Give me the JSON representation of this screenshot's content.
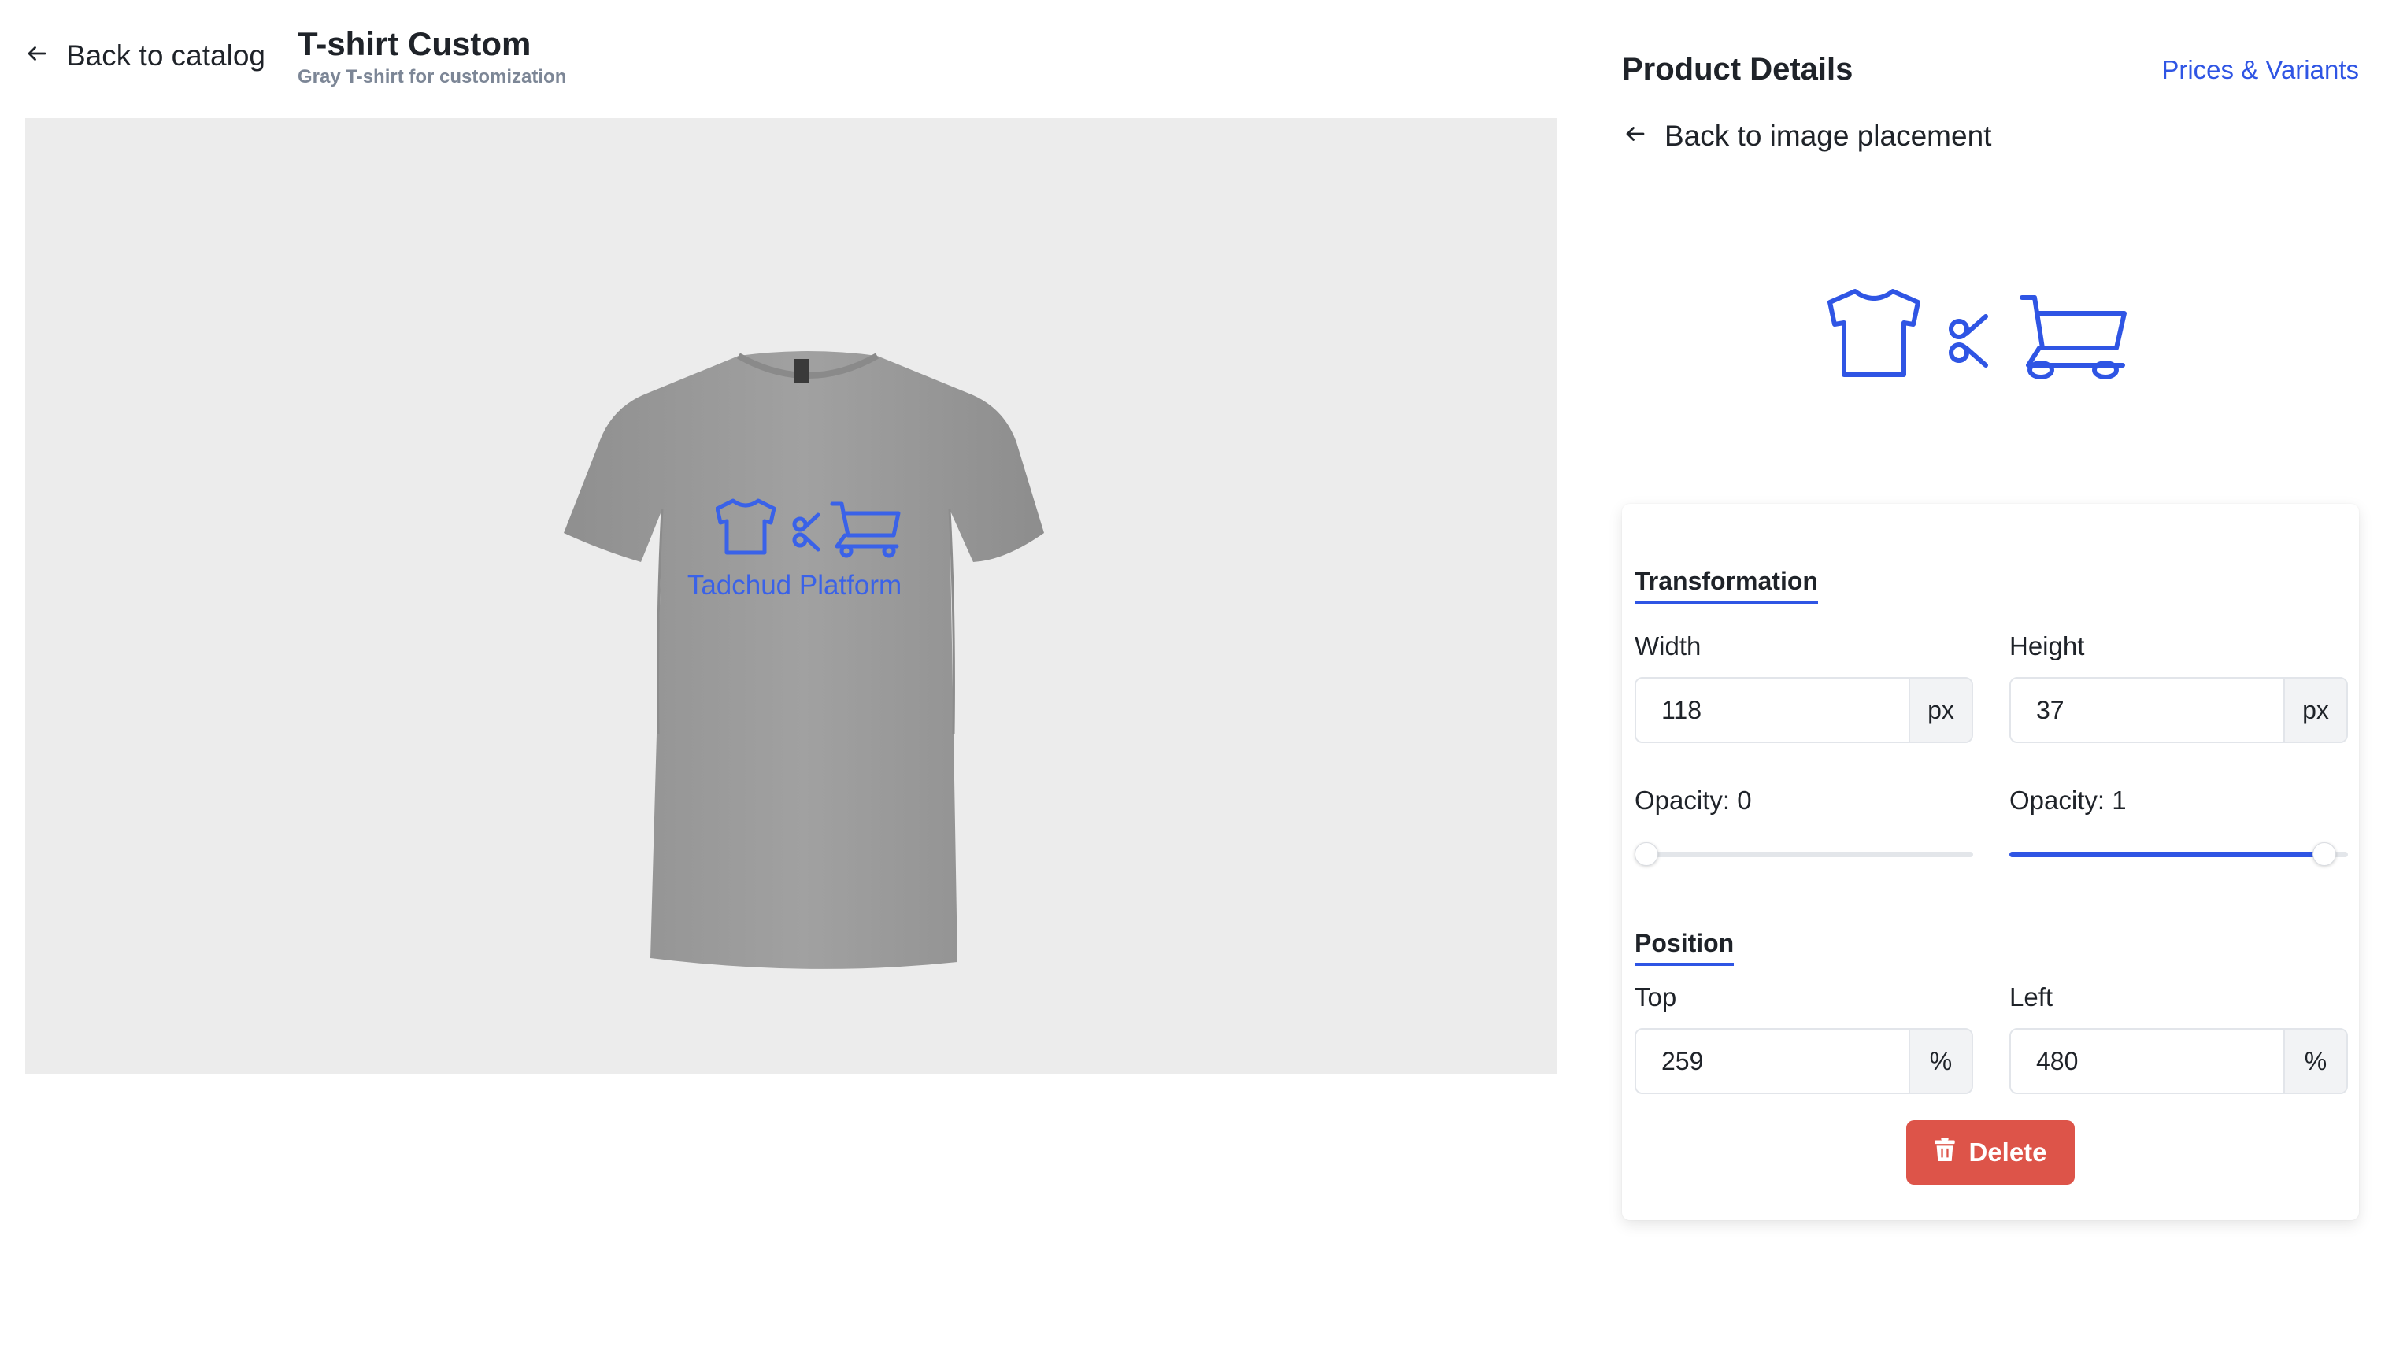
{
  "header": {
    "back_label": "Back to catalog",
    "title": "T-shirt Custom",
    "subtitle": "Gray T-shirt for customization"
  },
  "canvas": {
    "background": "#ececec",
    "design_text": "Tadchud Platform",
    "shirt_color": "#9a9a9a"
  },
  "panel": {
    "title": "Product Details",
    "prices_link": "Prices & Variants",
    "back_label": "Back to image placement",
    "logo_icons": [
      "tshirt-icon",
      "scissors-icon",
      "cart-icon"
    ]
  },
  "transformation": {
    "title": "Transformation",
    "width": {
      "label": "Width",
      "value": "118",
      "unit": "px"
    },
    "height": {
      "label": "Height",
      "value": "37",
      "unit": "px"
    },
    "opacity_left": {
      "label": "Opacity: 0",
      "value": 0
    },
    "opacity_right": {
      "label": "Opacity: 1",
      "value": 1
    }
  },
  "position": {
    "title": "Position",
    "top": {
      "label": "Top",
      "value": "259",
      "unit": "%"
    },
    "left": {
      "label": "Left",
      "value": "480",
      "unit": "%"
    }
  },
  "actions": {
    "delete_label": "Delete"
  },
  "colors": {
    "accent": "#2f55e4",
    "danger": "#dd5449"
  }
}
